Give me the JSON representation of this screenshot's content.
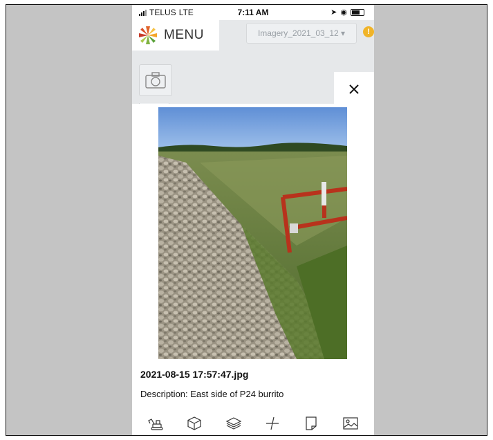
{
  "status_bar": {
    "carrier": "TELUS",
    "network": "LTE",
    "time": "7:11 AM"
  },
  "header": {
    "menu_label": "MENU",
    "imagery_selector": "Imagery_2021_03_12 ▾",
    "alert_badge": "!"
  },
  "modal": {
    "filename": "2021-08-15 17:57:47.jpg",
    "description": "Description: East side of P24 burrito",
    "close_icon": "close-icon"
  },
  "toolbar": {
    "tools": [
      "excavator-icon",
      "cube-icon",
      "layers-icon",
      "measure-icon",
      "note-icon",
      "image-icon"
    ]
  },
  "colors": {
    "background": "#c4c4c4",
    "alert": "#f0b429",
    "panel": "#ffffff"
  }
}
